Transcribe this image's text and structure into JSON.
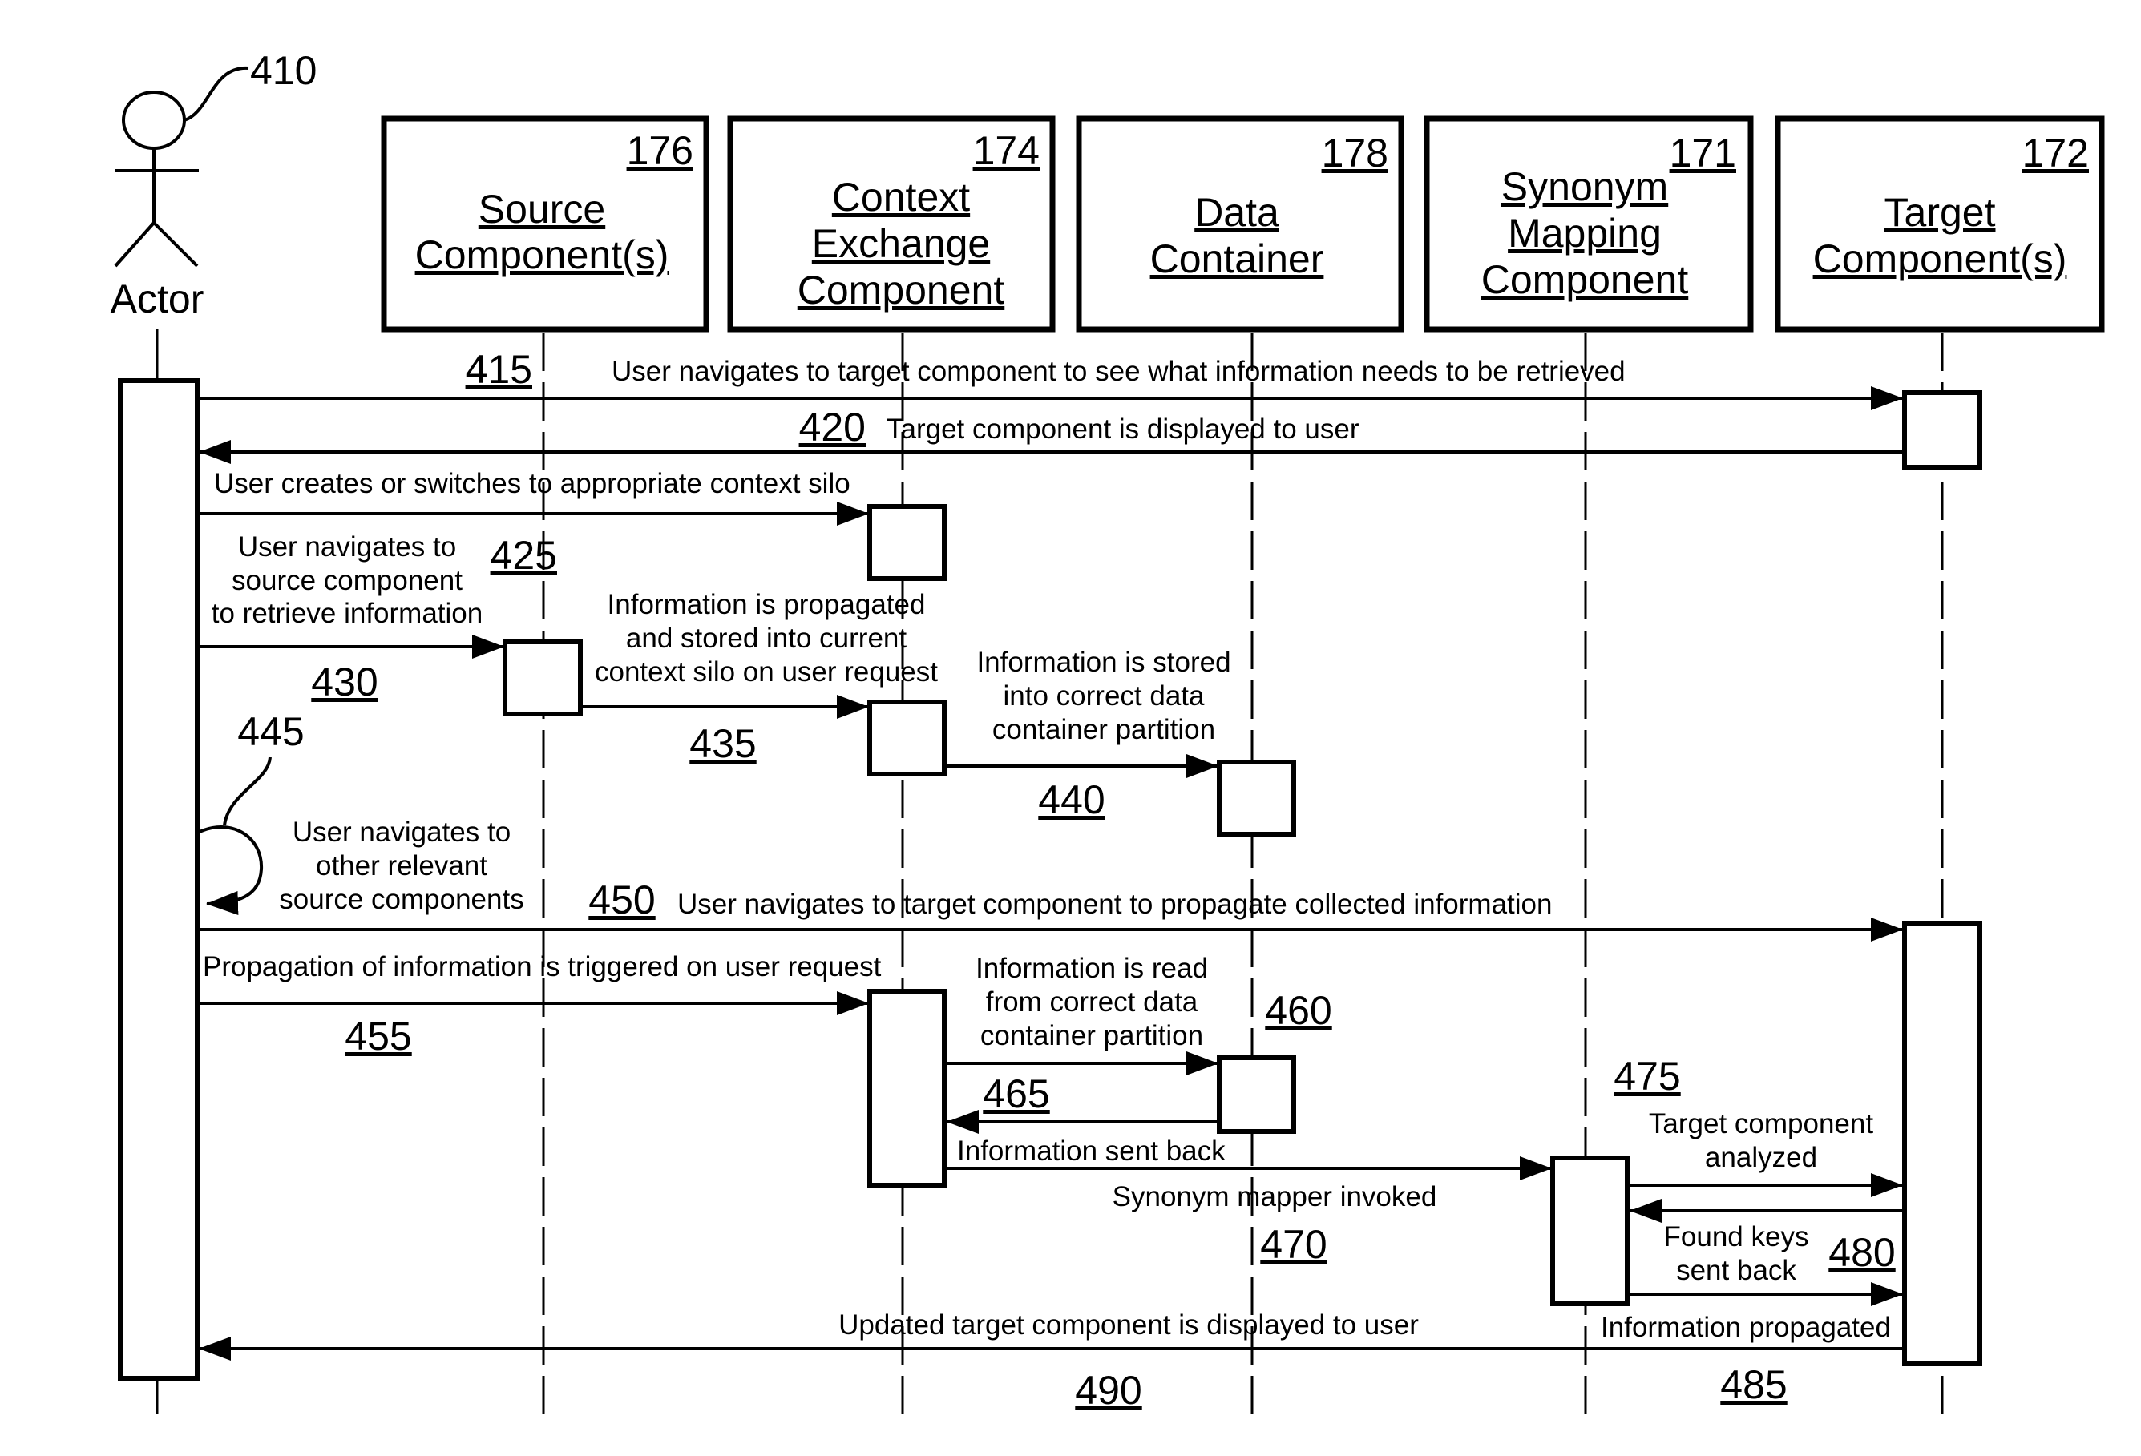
{
  "diagram": {
    "type": "sequence-diagram",
    "actor": {
      "label": "Actor",
      "ref": "410"
    },
    "participants": [
      {
        "id": "source",
        "ref": "176",
        "lines": [
          "Source",
          "Component(s)"
        ]
      },
      {
        "id": "context",
        "ref": "174",
        "lines": [
          "Context",
          "Exchange",
          "Component"
        ]
      },
      {
        "id": "data",
        "ref": "178",
        "lines": [
          "Data",
          "Container"
        ]
      },
      {
        "id": "synonym",
        "ref": "171",
        "lines": [
          "Synonym",
          "Mapping",
          "Component"
        ]
      },
      {
        "id": "target",
        "ref": "172",
        "lines": [
          "Target",
          "Component(s)"
        ]
      }
    ],
    "messages": [
      {
        "ref": "415",
        "from": "actor",
        "to": "target",
        "lines": [
          "User navigates to target component to see what information needs to be retrieved"
        ]
      },
      {
        "ref": "420",
        "from": "target",
        "to": "actor",
        "lines": [
          "Target component is displayed to user"
        ]
      },
      {
        "ref": "",
        "from": "actor",
        "to": "context",
        "lines": [
          "User creates or switches to appropriate context silo"
        ]
      },
      {
        "ref": "425",
        "from": "actor",
        "to": "source",
        "lines": [
          "User navigates to",
          "source component",
          "to retrieve information"
        ]
      },
      {
        "ref": "430",
        "from": "source",
        "to": "context",
        "lines": [
          "Information is propagated",
          "and stored into current",
          "context silo on user request"
        ]
      },
      {
        "ref": "435",
        "from": "context",
        "to": "data",
        "lines": [
          "Information is stored",
          "into correct data",
          "container partition"
        ]
      },
      {
        "ref": "440",
        "from": "",
        "to": "",
        "lines": []
      },
      {
        "ref": "445",
        "from": "actor",
        "to": "actor",
        "lines": [
          "User navigates to",
          "other relevant",
          "source components"
        ]
      },
      {
        "ref": "450",
        "from": "actor",
        "to": "target",
        "lines": [
          "User navigates to target component to propagate collected information"
        ]
      },
      {
        "ref": "455",
        "from": "actor",
        "to": "context",
        "lines": [
          "Propagation of information is triggered on user request"
        ]
      },
      {
        "ref": "460",
        "from": "context",
        "to": "data",
        "lines": [
          "Information is read",
          "from correct data",
          "container partition"
        ]
      },
      {
        "ref": "465",
        "from": "data",
        "to": "context",
        "lines": [
          "Information sent back"
        ]
      },
      {
        "ref": "470",
        "from": "context",
        "to": "synonym",
        "lines": [
          "Synonym mapper invoked"
        ]
      },
      {
        "ref": "475",
        "from": "synonym",
        "to": "target",
        "lines": [
          "Target component",
          "analyzed"
        ]
      },
      {
        "ref": "480",
        "from": "target",
        "to": "synonym",
        "lines": [
          "Found keys",
          "sent back"
        ]
      },
      {
        "ref": "485",
        "from": "synonym",
        "to": "target",
        "lines": [
          "Information propagated"
        ]
      },
      {
        "ref": "490",
        "from": "target",
        "to": "actor",
        "lines": [
          "Updated target component is displayed to user"
        ]
      }
    ]
  }
}
